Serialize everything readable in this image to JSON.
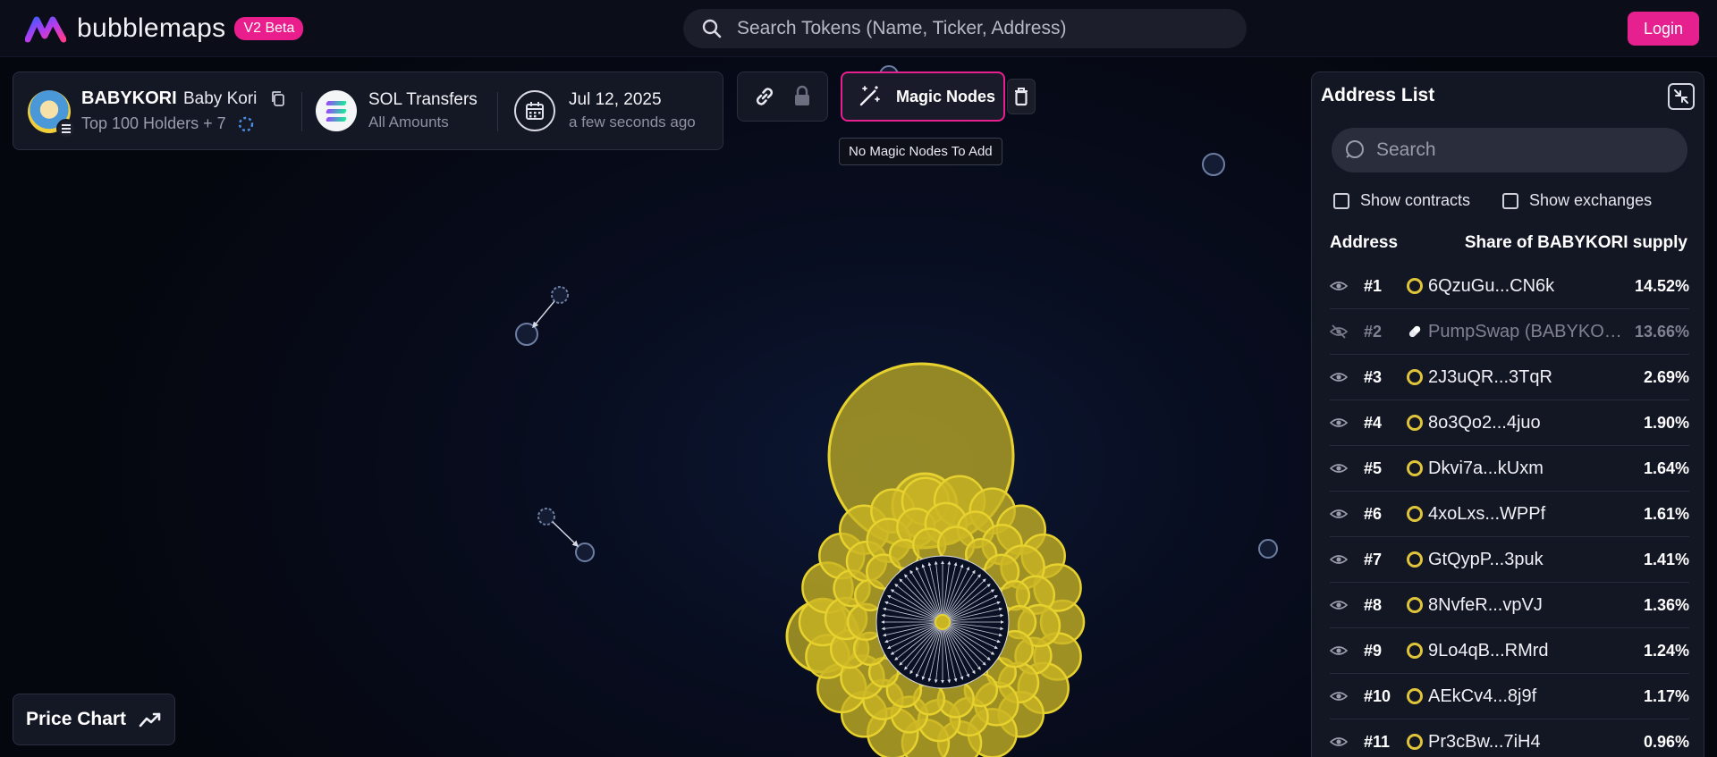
{
  "brand": {
    "name": "bubblemaps",
    "badge": "V2 Beta"
  },
  "search": {
    "placeholder": "Search Tokens (Name, Ticker, Address)"
  },
  "auth": {
    "login_label": "Login"
  },
  "token": {
    "ticker": "BABYKORI",
    "name": "Baby Kori",
    "holders_label": "Top 100 Holders + 7",
    "transfers_title": "SOL Transfers",
    "transfers_sub": "All Amounts",
    "date": "Jul 12, 2025",
    "date_sub": "a few seconds ago"
  },
  "toolbar": {
    "magic_label": "Magic Nodes",
    "tooltip": "No Magic Nodes To Add",
    "price_chart_label": "Price Chart"
  },
  "address_list": {
    "title": "Address List",
    "search_placeholder": "Search",
    "show_contracts": "Show contracts",
    "show_exchanges": "Show exchanges",
    "col_address": "Address",
    "col_share": "Share of BABYKORI supply",
    "rows": [
      {
        "rank": "#1",
        "address": "6QzuGu...CN6k",
        "share": "14.52%"
      },
      {
        "rank": "#2",
        "address": "PumpSwap (BABYKORI...",
        "share": "13.66%"
      },
      {
        "rank": "#3",
        "address": "2J3uQR...3TqR",
        "share": "2.69%"
      },
      {
        "rank": "#4",
        "address": "8o3Qo2...4juo",
        "share": "1.90%"
      },
      {
        "rank": "#5",
        "address": "Dkvi7a...kUxm",
        "share": "1.64%"
      },
      {
        "rank": "#6",
        "address": "4xoLxs...WPPf",
        "share": "1.61%"
      },
      {
        "rank": "#7",
        "address": "GtQypP...3puk",
        "share": "1.41%"
      },
      {
        "rank": "#8",
        "address": "8NvfeR...vpVJ",
        "share": "1.36%"
      },
      {
        "rank": "#9",
        "address": "9Lo4qB...RMrd",
        "share": "1.24%"
      },
      {
        "rank": "#10",
        "address": "AEkCv4...8j9f",
        "share": "1.17%"
      },
      {
        "rank": "#11",
        "address": "Pr3cBw...7iH4",
        "share": "0.96%"
      }
    ]
  },
  "colors": {
    "accent": "#e6208f",
    "bubble": "#c9b524",
    "bubble_stroke": "#e6d12e",
    "node": "#6d7ea3"
  }
}
